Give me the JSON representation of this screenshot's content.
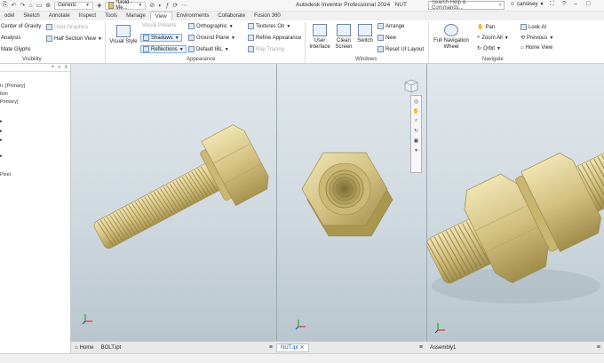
{
  "title": {
    "app": "Autodesk Inventor Professional 2024",
    "document": "NUT",
    "qa_combo": "Generic",
    "material_combo": "*Gold - Me..."
  },
  "search": {
    "placeholder": "Search Help & Commands..."
  },
  "user": {
    "name": "cansisey"
  },
  "tabs": [
    "odel",
    "Sketch",
    "Annotate",
    "Inspect",
    "Tools",
    "Manage",
    "View",
    "Environments",
    "Collaborate",
    "Fusion 360"
  ],
  "active_tab": "View",
  "ribbon": {
    "visibility": {
      "items": [
        "Center of Gravity",
        "Analysis",
        "Mate Glyphs"
      ],
      "user_graphics": "User Graphics",
      "half_section": "Half Section View",
      "label": "Visibility"
    },
    "appearance": {
      "visual_style": "Visual Style",
      "visual_preset": "Visual Presets",
      "shadows": "Shadows",
      "reflections": "Reflections",
      "orthographic": "Orthographic",
      "ground_plane": "Ground Plane",
      "default_ibl": "Default IBL",
      "textures_on": "Textures On",
      "refine_appearance": "Refine Appearance",
      "ray_tracing": "Ray Tracing",
      "label": "Appearance"
    },
    "windows": {
      "user_interface": "User\nInterface",
      "clean_screen": "Clean\nScreen",
      "switch": "Switch",
      "arrange": "Arrange",
      "new": "New",
      "reset_ui": "Reset UI Layout",
      "label": "Windows"
    },
    "navigate": {
      "full_nav_wheel": "Full Navigation\nWheel",
      "pan": "Pan",
      "zoom_all": "Zoom All",
      "orbit": "Orbit",
      "look_at": "Look At",
      "previous": "Previous",
      "home_view": "Home View",
      "label": "Navigate"
    }
  },
  "browser": {
    "items": [
      "n: [Primary]",
      "tion",
      "Primary]",
      "",
      "",
      "",
      "",
      "Pixel"
    ]
  },
  "doc_tabs": [
    {
      "label": "Home",
      "active": false
    },
    {
      "label": "BOLT.ipt",
      "active": false
    },
    {
      "label": "NUT.ipt",
      "active": true
    },
    {
      "label": "Assembly1",
      "active": false
    }
  ],
  "colors": {
    "gold": "#d9c58a",
    "gold_dark": "#a2904f",
    "accent": "#1f5fa8",
    "viewport_top": "#e2e8ec",
    "viewport_bottom": "#b9c6ce"
  }
}
